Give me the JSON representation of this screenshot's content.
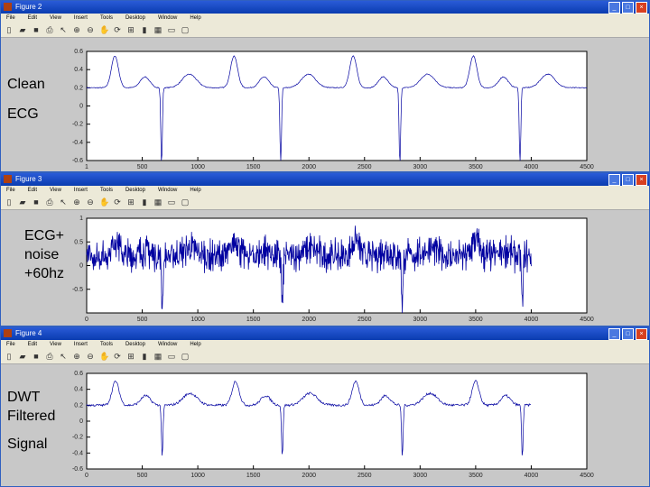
{
  "windows": [
    {
      "title": "Figure 2",
      "menu": [
        "File",
        "Edit",
        "View",
        "Insert",
        "Tools",
        "Desktop",
        "Window",
        "Help"
      ],
      "label_lines": [
        "Clean",
        "ECG"
      ]
    },
    {
      "title": "Figure 3",
      "menu": [
        "File",
        "Edit",
        "View",
        "Insert",
        "Tools",
        "Desktop",
        "Window",
        "Help"
      ],
      "label_lines": [
        "ECG+",
        "noise",
        "+60hz"
      ]
    },
    {
      "title": "Figure 4",
      "menu": [
        "File",
        "Edit",
        "View",
        "Insert",
        "Tools",
        "Desktop",
        "Window",
        "Help"
      ],
      "label_lines": [
        "DWT",
        "Filtered",
        "Signal"
      ]
    }
  ],
  "toolbar_icons": [
    "new-file-icon",
    "open-icon",
    "save-icon",
    "print-icon",
    "pointer-icon",
    "zoom-in-icon",
    "zoom-out-icon",
    "pan-icon",
    "rotate-icon",
    "data-cursor-icon",
    "colorbar-icon",
    "legend-icon",
    "hide-plot-tools-icon",
    "show-plot-tools-icon"
  ],
  "line_color": "#0000a0",
  "chart_data": [
    {
      "type": "line",
      "title": "Clean ECG",
      "xlim": [
        0,
        4500
      ],
      "ylim": [
        -0.6,
        0.6
      ],
      "xticks": [
        "1",
        "500",
        "1000",
        "1500",
        "2000",
        "2500",
        "3000",
        "3500",
        "4000",
        "4500"
      ],
      "yticks": [
        "0.6",
        "0.4",
        "0.2",
        "0",
        "-0.2",
        "-0.4",
        "-0.6"
      ],
      "length": 4500,
      "baseline": 0.2,
      "beats": [
        674,
        1746,
        2818,
        3899
      ],
      "r_min": -0.6,
      "t_peak": 0.55,
      "noise": 0.01
    },
    {
      "type": "line",
      "title": "ECG+noise+60hz",
      "xlim": [
        0,
        4500
      ],
      "ylim": [
        -1,
        1
      ],
      "xticks": [
        "0",
        "500",
        "1000",
        "1500",
        "2000",
        "2500",
        "3000",
        "3500",
        "4000",
        "4500"
      ],
      "yticks": [
        "1",
        "0.5",
        "0",
        "-0.5"
      ],
      "length": 4000,
      "baseline": 0.2,
      "beats": [
        680,
        1760,
        2840,
        3920
      ],
      "r_min": -0.8,
      "t_peak": 0.55,
      "noise": 0.25
    },
    {
      "type": "line",
      "title": "DWT Filtered Signal",
      "xlim": [
        0,
        4500
      ],
      "ylim": [
        -0.6,
        0.6
      ],
      "xticks": [
        "0",
        "500",
        "1000",
        "1500",
        "2000",
        "2500",
        "3000",
        "3500",
        "4000",
        "4500"
      ],
      "yticks": [
        "0.6",
        "0.4",
        "0.2",
        "0",
        "-0.2",
        "-0.4",
        "-0.6"
      ],
      "length": 4000,
      "baseline": 0.2,
      "beats": [
        680,
        1760,
        2840,
        3920
      ],
      "r_min": -0.4,
      "t_peak": 0.5,
      "noise": 0.03
    }
  ]
}
